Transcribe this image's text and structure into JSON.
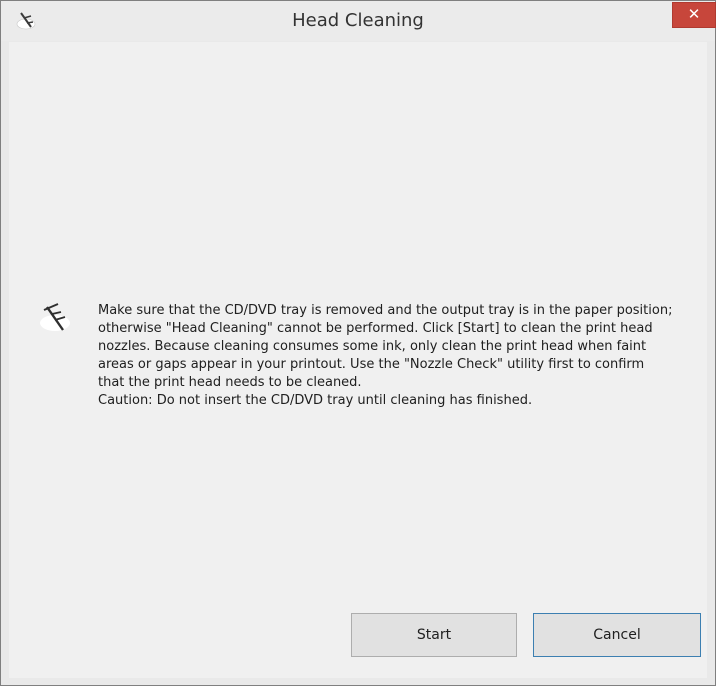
{
  "window": {
    "title": "Head Cleaning",
    "close_label": "✕"
  },
  "message": {
    "paragraph": "Make sure that the CD/DVD tray is removed and the output tray is in the paper position; otherwise \"Head Cleaning\" cannot be performed. Click [Start] to clean the print head nozzles. Because cleaning consumes some ink, only clean the print head when faint areas or gaps appear in your printout. Use the \"Nozzle Check\" utility first to confirm that the print head needs to be cleaned.",
    "caution": "Caution: Do not insert the CD/DVD tray until cleaning has finished."
  },
  "buttons": {
    "start_label": "Start",
    "cancel_label": "Cancel"
  },
  "icons": {
    "app": "print-head-icon",
    "message": "print-head-icon",
    "close": "close-icon"
  },
  "colors": {
    "close_button": "#c7463b",
    "default_button_border": "#3c7fb1",
    "client_background": "#f0f0f0"
  }
}
